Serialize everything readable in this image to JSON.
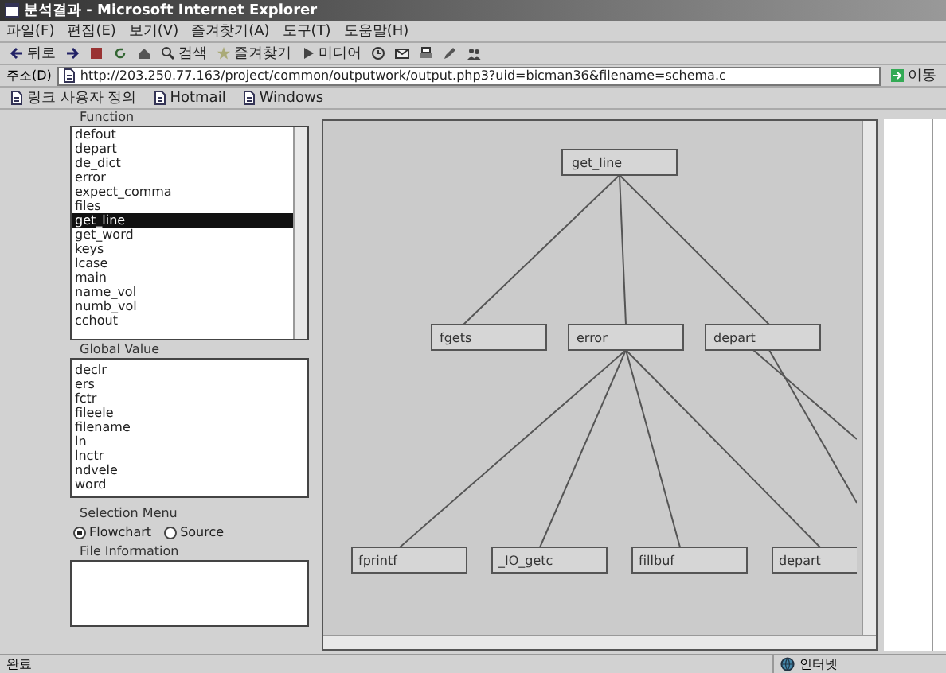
{
  "window": {
    "title": "분석결과 - Microsoft Internet Explorer"
  },
  "menu": [
    "파일(F)",
    "편집(E)",
    "보기(V)",
    "즐겨찾기(A)",
    "도구(T)",
    "도움말(H)"
  ],
  "toolbar": [
    {
      "kind": "back",
      "label": "뒤로"
    },
    {
      "kind": "forward"
    },
    {
      "kind": "stop"
    },
    {
      "kind": "refresh"
    },
    {
      "kind": "home"
    },
    {
      "kind": "search",
      "label": "검색"
    },
    {
      "kind": "favorites",
      "label": "즐겨찾기"
    },
    {
      "kind": "media",
      "label": "미디어"
    },
    {
      "kind": "history"
    },
    {
      "kind": "mail"
    },
    {
      "kind": "print"
    },
    {
      "kind": "edit"
    },
    {
      "kind": "messenger"
    }
  ],
  "address": {
    "label": "주소(D)",
    "value": "http://203.250.77.163/project/common/outputwork/output.php3?uid=bicman36&filename=schema.c",
    "go": "이동"
  },
  "links": [
    {
      "label": "링크 사용자 정의"
    },
    {
      "label": "Hotmail"
    },
    {
      "label": "Windows"
    }
  ],
  "functions": {
    "title": "Function",
    "items": [
      {
        "label": "defout",
        "selected": false
      },
      {
        "label": "depart",
        "selected": false
      },
      {
        "label": "de_dict",
        "selected": false
      },
      {
        "label": "error",
        "selected": false
      },
      {
        "label": "expect_comma",
        "selected": false
      },
      {
        "label": "files",
        "selected": false
      },
      {
        "label": "get_line",
        "selected": true
      },
      {
        "label": "get_word",
        "selected": false
      },
      {
        "label": "keys",
        "selected": false
      },
      {
        "label": "lcase",
        "selected": false
      },
      {
        "label": "main",
        "selected": false
      },
      {
        "label": "name_vol",
        "selected": false
      },
      {
        "label": "numb_vol",
        "selected": false
      },
      {
        "label": "cchout",
        "selected": false
      }
    ]
  },
  "global_values": {
    "title": "Global Value",
    "items": [
      "declr",
      "ers",
      "fctr",
      "fileele",
      "filename",
      "ln",
      "lnctr",
      "ndvele",
      "word"
    ]
  },
  "selection_menu": {
    "title": "Selection Menu",
    "options": [
      {
        "label": "Flowchart",
        "selected": true
      },
      {
        "label": "Source",
        "selected": false
      }
    ]
  },
  "file_information": {
    "title": "File Information"
  },
  "flowchart": {
    "label": "get_line",
    "children": [
      {
        "label": "fgets"
      },
      {
        "label": "error",
        "children": [
          {
            "label": "fprintf"
          },
          {
            "label": "_IO_getc"
          },
          {
            "label": "fillbuf"
          },
          {
            "label": "depart"
          }
        ]
      },
      {
        "label": "depart"
      }
    ]
  },
  "status_bar": {
    "text": "완료",
    "zone": "인터넷"
  }
}
